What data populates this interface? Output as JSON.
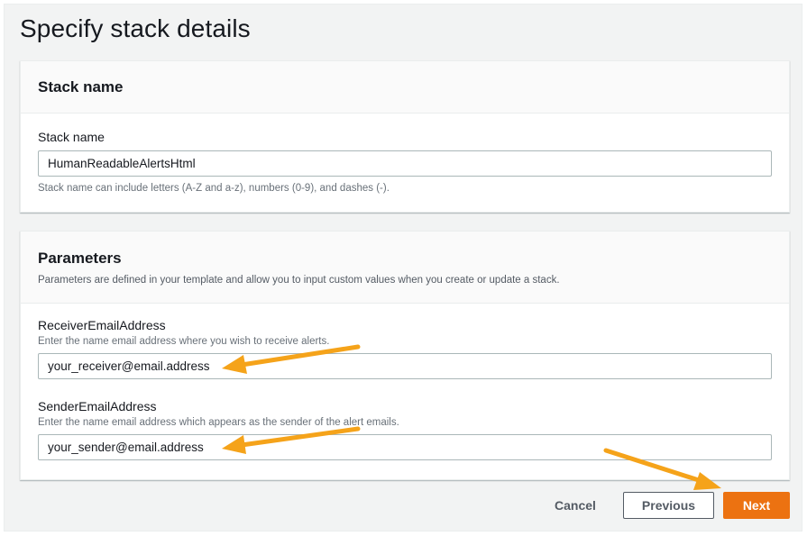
{
  "page": {
    "title": "Specify stack details"
  },
  "stack_name_section": {
    "title": "Stack name",
    "field_label": "Stack name",
    "field_value": "HumanReadableAlertsHtml",
    "field_hint": "Stack name can include letters (A-Z and a-z), numbers (0-9), and dashes (-)."
  },
  "parameters_section": {
    "title": "Parameters",
    "description": "Parameters are defined in your template and allow you to input custom values when you create or update a stack.",
    "receiver": {
      "label": "ReceiverEmailAddress",
      "hint": "Enter the name email address where you wish to receive alerts.",
      "value": "your_receiver@email.address"
    },
    "sender": {
      "label": "SenderEmailAddress",
      "hint": "Enter the name email address which appears as the sender of the alert emails.",
      "value": "your_sender@email.address"
    }
  },
  "actions": {
    "cancel_label": "Cancel",
    "previous_label": "Previous",
    "next_label": "Next"
  },
  "annotations": {
    "arrow_color": "#f5a31a",
    "primary_color": "#ec7211"
  }
}
